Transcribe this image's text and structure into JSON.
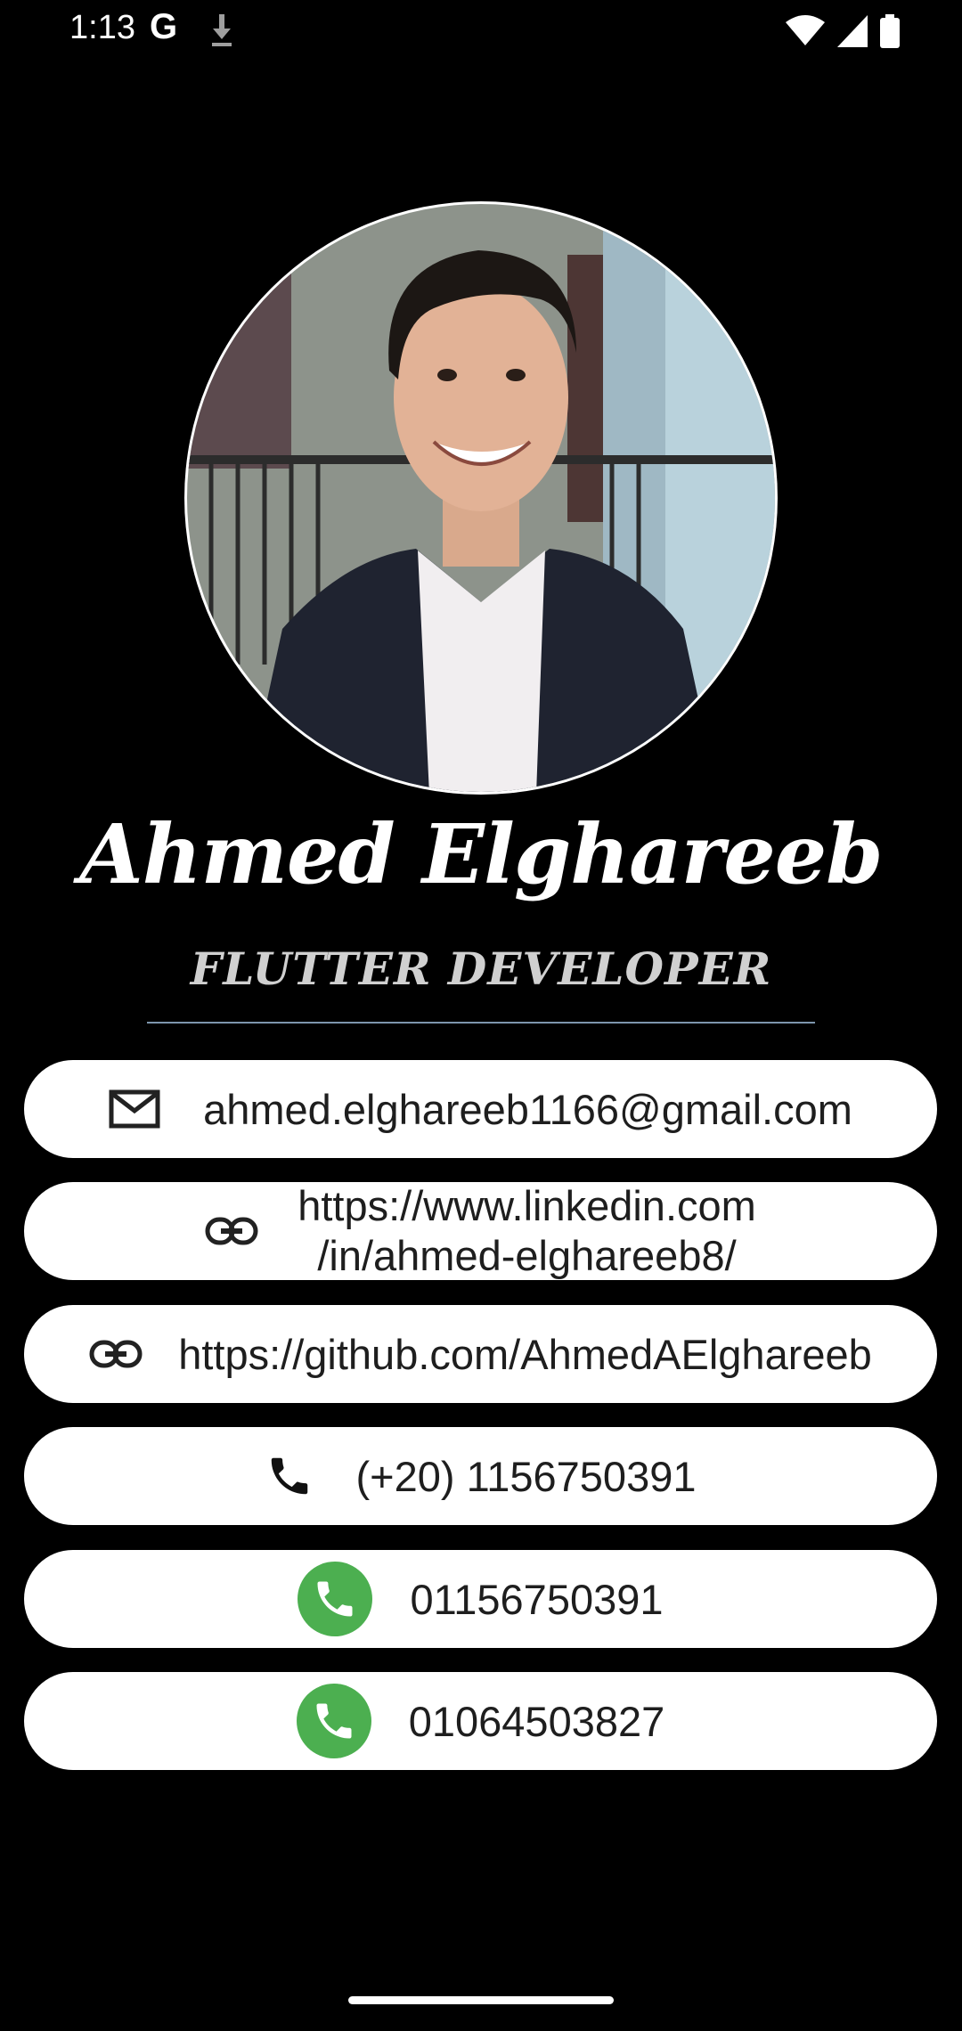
{
  "status_bar": {
    "time": "1:13",
    "google_glyph": "G",
    "icons": [
      "google-icon",
      "download-icon",
      "wifi-icon",
      "signal-icon",
      "battery-icon"
    ]
  },
  "profile": {
    "name": "Ahmed Elghareeb",
    "role": "FLUTTER DEVELOPER"
  },
  "contacts": {
    "email": {
      "icon": "mail-icon",
      "text": "ahmed.elghareeb1166@gmail.com"
    },
    "linkedin": {
      "icon": "link-icon",
      "line1": "https://www.linkedin.com",
      "line2": "/in/ahmed-elghareeb8/"
    },
    "github": {
      "icon": "link-icon",
      "text": "https://github.com/AhmedAElghareeb"
    },
    "phone": {
      "icon": "phone-icon",
      "text": "(+20) 1156750391"
    },
    "whatsapp_1": {
      "icon": "whatsapp-icon",
      "text": "01156750391"
    },
    "whatsapp_2": {
      "icon": "whatsapp-icon",
      "text": "01064503827"
    }
  },
  "colors": {
    "background": "#000000",
    "card": "#ffffff",
    "whatsapp_green": "#4caf50",
    "divider": "#7d95ad"
  }
}
